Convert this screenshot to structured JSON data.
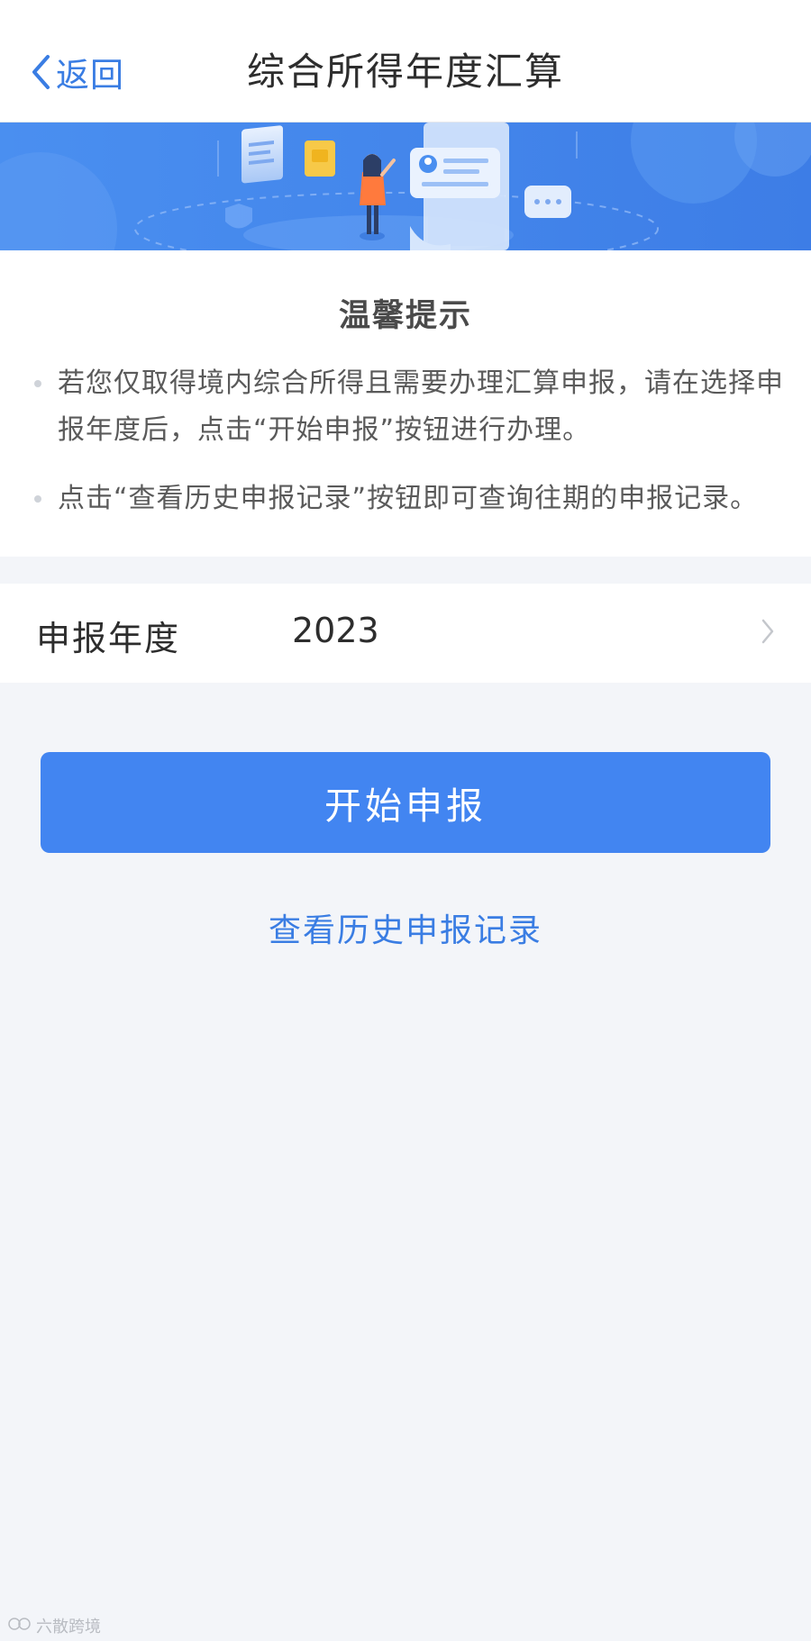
{
  "navbar": {
    "back_label": "返回",
    "title": "综合所得年度汇算"
  },
  "banner": {
    "accent_color": "#4a8ff0"
  },
  "tips": {
    "title": "温馨提示",
    "items": [
      {
        "text": "若您仅取得境内综合所得且需要办理汇算申报，请在选择申报年度后，点击“开始申报”按钮进行办理。"
      },
      {
        "text": "点击“查看历史申报记录”按钮即可查询往期的申报记录。"
      }
    ]
  },
  "year_selector": {
    "label": "申报年度",
    "value": "2023"
  },
  "actions": {
    "start_label": "开始申报",
    "history_label": "查看历史申报记录"
  },
  "watermark": {
    "text": "六散跨境"
  },
  "colors": {
    "primary": "#4285f1",
    "link": "#3a7de3",
    "background": "#f3f5f9"
  }
}
